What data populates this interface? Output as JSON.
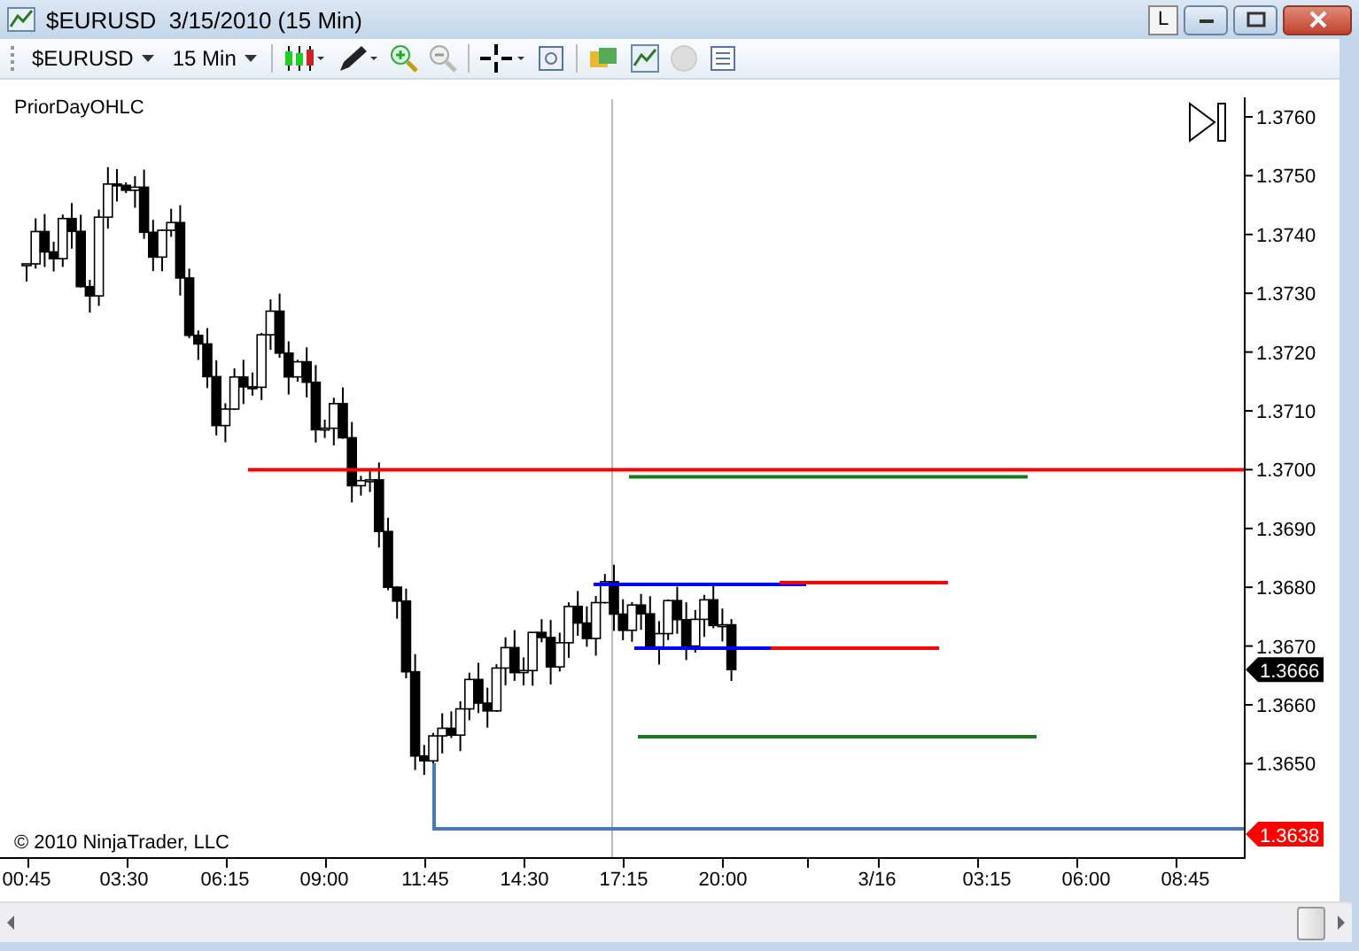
{
  "window": {
    "title": "$EURUSD  3/15/2010 (15 Min)",
    "buttons": [
      "L"
    ]
  },
  "toolbar": {
    "instrument": "$EURUSD",
    "interval": "15 Min"
  },
  "chart": {
    "indicator_label": "PriorDayOHLC",
    "copyright": "© 2010 NinjaTrader, LLC",
    "price_labels": [
      "1.3760",
      "1.3750",
      "1.3740",
      "1.3730",
      "1.3720",
      "1.3710",
      "1.3700",
      "1.3690",
      "1.3680",
      "1.3670",
      "1.3660",
      "1.3650"
    ],
    "time_labels": [
      "00:45",
      "03:30",
      "06:15",
      "09:00",
      "11:45",
      "14:30",
      "17:15",
      "20:00",
      "3/16",
      "03:15",
      "06:00",
      "08:45"
    ],
    "price_markers": [
      {
        "label": "1.3666",
        "color": "#000000"
      },
      {
        "label": "1.3638",
        "color": "#ff0000"
      }
    ]
  }
}
